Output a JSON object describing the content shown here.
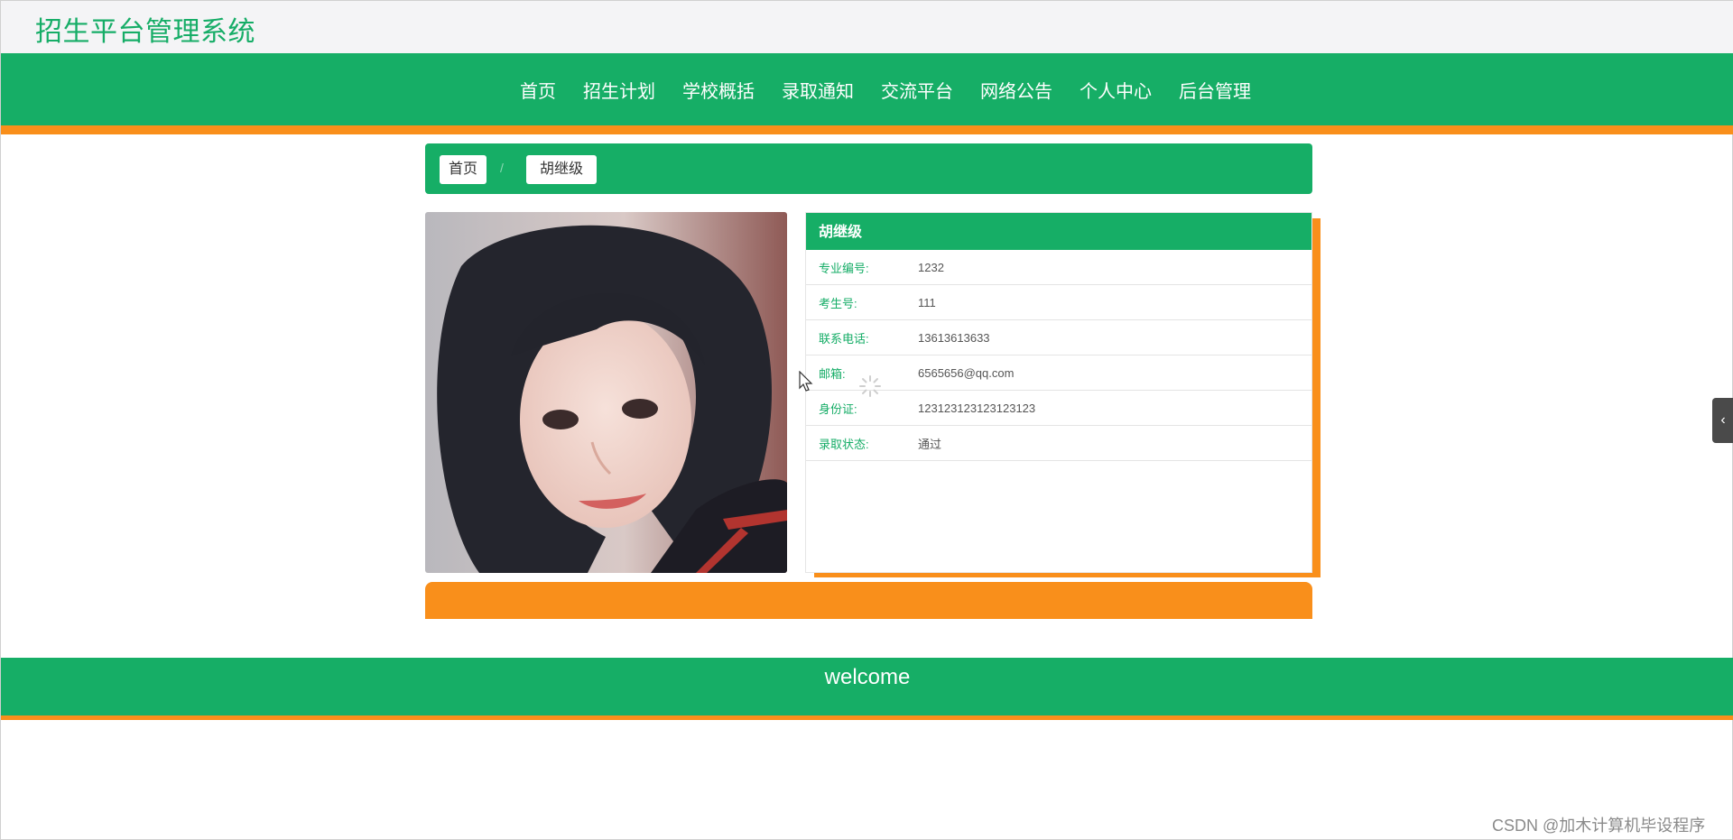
{
  "header": {
    "site_title": "招生平台管理系统"
  },
  "nav": {
    "items": [
      {
        "label": "首页"
      },
      {
        "label": "招生计划"
      },
      {
        "label": "学校概括"
      },
      {
        "label": "录取通知"
      },
      {
        "label": "交流平台"
      },
      {
        "label": "网络公告"
      },
      {
        "label": "个人中心"
      },
      {
        "label": "后台管理"
      }
    ]
  },
  "breadcrumb": {
    "home": "首页",
    "separator": "/",
    "current": "胡继级"
  },
  "detail": {
    "name": "胡继级",
    "fields": [
      {
        "label": "专业编号:",
        "value": "1232"
      },
      {
        "label": "考生号:",
        "value": "111"
      },
      {
        "label": "联系电话:",
        "value": "13613613633"
      },
      {
        "label": "邮箱:",
        "value": "6565656@qq.com"
      },
      {
        "label": "身份证:",
        "value": "123123123123123123"
      },
      {
        "label": "录取状态:",
        "value": "通过"
      }
    ]
  },
  "footer": {
    "text": "welcome"
  },
  "side_toggle": {
    "icon": "chevron-left-icon",
    "glyph": "‹"
  },
  "watermark": "CSDN @加木计算机毕设程序",
  "colors": {
    "primary": "#16ae66",
    "accent": "#f98f1b",
    "topbar_bg": "#f4f4f6"
  }
}
